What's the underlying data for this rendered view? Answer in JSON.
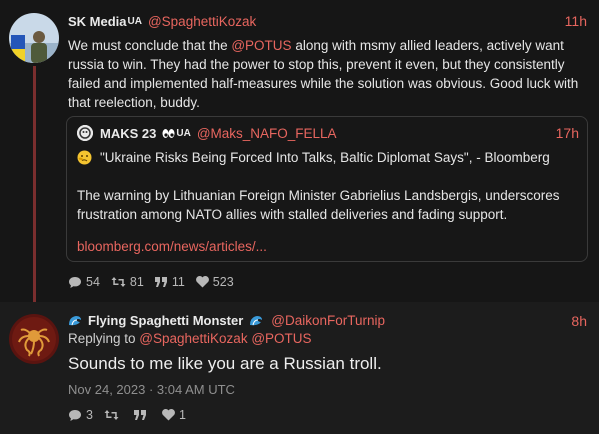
{
  "post1": {
    "display_name": "SK Media",
    "name_badge": "UA",
    "handle": "@SpaghettiKozak",
    "time": "11h",
    "text_pre": "We must conclude that the ",
    "text_mention": "@POTUS",
    "text_post": " along with msmy allied leaders, actively want russia to win. They had the power to stop this, prevent it even, but they consistently failed and implemented half-measures while the solution was obvious. Good luck with that reelection, buddy.",
    "quote": {
      "display_name": "MAKS 23",
      "name_badge": "UA",
      "handle": "@Maks_NAFO_FELLA",
      "time": "17h",
      "headline": "\"Ukraine Risks Being Forced Into Talks, Baltic Diplomat Says\", - Bloomberg",
      "paragraph": "The warning by Lithuanian Foreign Minister Gabrielius Landsbergis, underscores frustration among NATO allies with stalled deliveries and fading support.",
      "link": "bloomberg.com/news/articles/..."
    },
    "stats": {
      "replies": "54",
      "reposts": "81",
      "quotes": "11",
      "likes": "523"
    }
  },
  "post2": {
    "display_name": "Flying Spaghetti Monster",
    "handle": "@DaikonForTurnip",
    "time": "8h",
    "replying_label": "Replying to ",
    "replying_handles": "@SpaghettiKozak @POTUS",
    "text": "Sounds to me like you are a Russian troll.",
    "date": "Nov 24, 2023 · 3:04 AM UTC",
    "stats": {
      "replies": "3",
      "likes": "1"
    }
  },
  "colors": {
    "accent": "#e8665f",
    "background": "#161616",
    "thread_line": "#7a2e2e"
  }
}
